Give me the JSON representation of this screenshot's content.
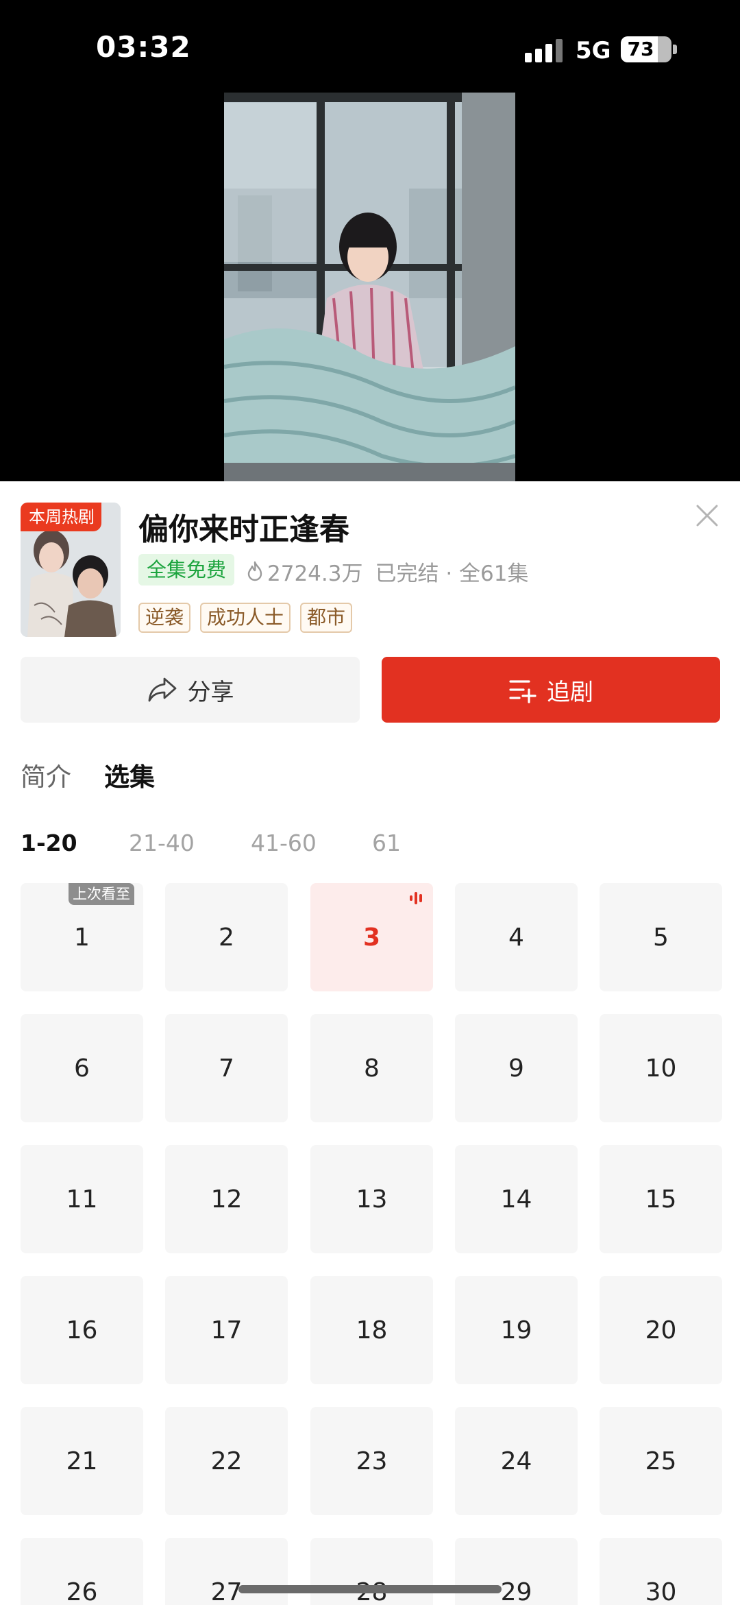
{
  "status_bar": {
    "time": "03:32",
    "network": "5G",
    "battery": "73",
    "battery_level": 0.73
  },
  "player": {
    "icon": "video-poster"
  },
  "drama": {
    "cover_badge": "本周热剧",
    "title": "偏你来时正逢春",
    "free_tag": "全集免费",
    "heat": "2724.3万",
    "status": "已完结 · 全61集",
    "tags": [
      "逆袭",
      "成功人士",
      "都市"
    ]
  },
  "actions": {
    "share_label": "分享",
    "follow_label": "追剧",
    "follow_color": "#e23121"
  },
  "tabs": {
    "intro": "简介",
    "episodes": "选集"
  },
  "episode_ranges": [
    "1-20",
    "21-40",
    "41-60",
    "61"
  ],
  "episodes": {
    "last_watched_label": "上次看至",
    "current": "3",
    "visible": [
      "1",
      "2",
      "3",
      "4",
      "5",
      "6",
      "7",
      "8",
      "9",
      "10",
      "11",
      "12",
      "13",
      "14",
      "15",
      "16",
      "17",
      "18",
      "19",
      "20",
      "21",
      "22",
      "23",
      "24",
      "25",
      "26",
      "27",
      "28",
      "29",
      "30"
    ]
  },
  "colors": {
    "accent_red": "#e23121",
    "free_green": "#1ca43e"
  }
}
